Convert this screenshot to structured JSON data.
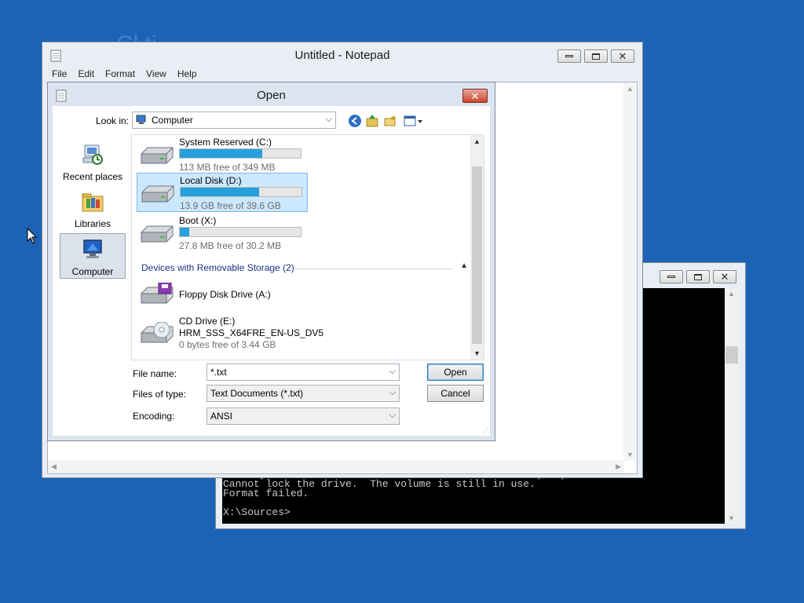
{
  "console": {
    "lines": "Would you like to force a dismount on this volume? (Y/N) Y\nCannot lock the drive.  The volume is still in use.\nFormat failed.\n\nX:\\Sources>"
  },
  "notepad": {
    "title": "Untitled - Notepad",
    "menu": [
      "File",
      "Edit",
      "Format",
      "View",
      "Help"
    ]
  },
  "open_dialog": {
    "title": "Open",
    "look_in_label": "Look in:",
    "look_in_value": "Computer",
    "places": [
      "Recent places",
      "Libraries",
      "Computer"
    ],
    "drives": [
      {
        "name": "System Reserved (C:)",
        "free": "113 MB free of 349 MB",
        "used_fraction": 0.68
      },
      {
        "name": "Local Disk (D:)",
        "free": "13.9 GB free of 39.6 GB",
        "used_fraction": 0.65
      },
      {
        "name": "Boot (X:)",
        "free": "27.8 MB free of 30.2 MB",
        "used_fraction": 0.08
      }
    ],
    "removable_header": "Devices with Removable Storage (2)",
    "removable": [
      {
        "name": "Floppy Disk Drive (A:)"
      },
      {
        "name": "CD Drive (E:)",
        "label": "HRM_SSS_X64FRE_EN-US_DV5",
        "free": "0 bytes free of 3.44 GB"
      }
    ],
    "file_name_label": "File name:",
    "file_name_value": "*.txt",
    "files_of_type_label": "Files of type:",
    "files_of_type_value": "Text Documents (*.txt)",
    "encoding_label": "Encoding:",
    "encoding_value": "ANSI",
    "open_button": "Open",
    "cancel_button": "Cancel"
  },
  "desktop": {
    "ghost_text": "Cl              ti"
  }
}
